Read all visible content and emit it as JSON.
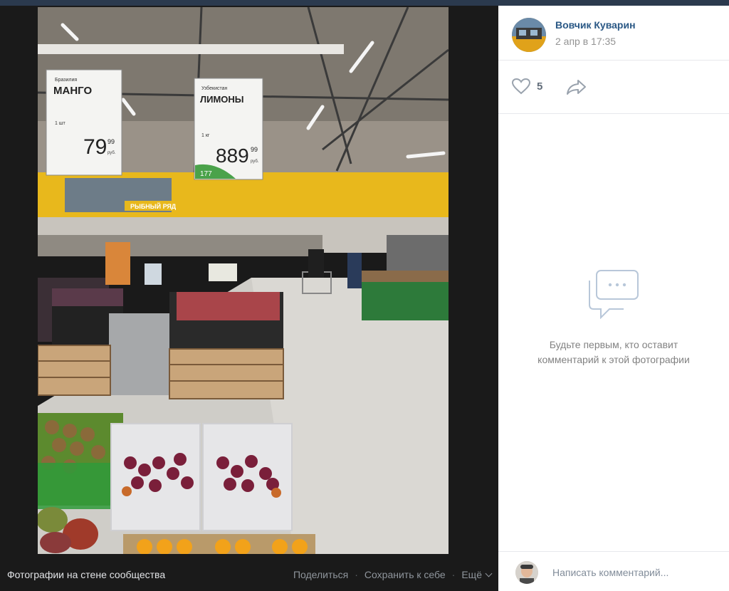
{
  "photo": {
    "signs": [
      {
        "origin": "Бразилия",
        "name": "МАНГО",
        "unit": "1 шт",
        "price": "79",
        "cents": "99",
        "currency": "руб."
      },
      {
        "origin": "Узбекистан",
        "name": "ЛИМОНЫ",
        "unit": "1 кг",
        "price": "889",
        "cents": "99",
        "currency": "руб.",
        "badge": "177"
      }
    ],
    "store_banner": "РЫБНЫЙ РЯД"
  },
  "footer": {
    "album_link": "Фотографии на стене сообщества",
    "share_label": "Поделиться",
    "save_label": "Сохранить к себе",
    "more_label": "Ещё"
  },
  "author": {
    "name": "Вовчик Куварин",
    "date": "2 апр в 17:35"
  },
  "likes": {
    "count": "5"
  },
  "comments": {
    "empty_text": "Будьте первым, кто оставит комментарий к этой фотографии",
    "input_placeholder": "Написать комментарий..."
  },
  "colors": {
    "author_link": "#2a5885",
    "sidebar_bg": "#ffffff",
    "viewer_bg": "#1a1a1a"
  },
  "icons": {
    "like": "heart-icon",
    "share": "share-arrow-icon",
    "empty": "comments-bubble-icon",
    "more": "chevron-down-icon"
  }
}
